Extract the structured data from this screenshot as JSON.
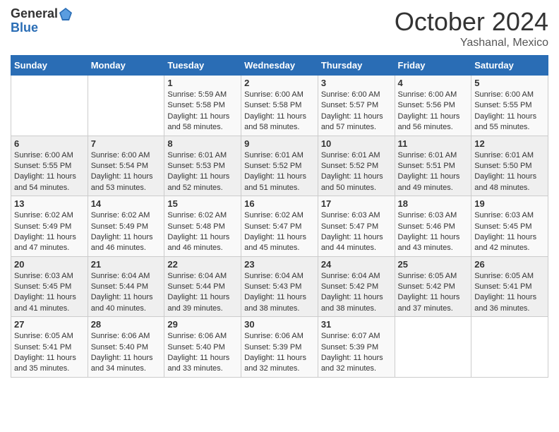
{
  "header": {
    "logo": {
      "general": "General",
      "blue": "Blue"
    },
    "title": "October 2024",
    "location": "Yashanal, Mexico"
  },
  "weekdays": [
    "Sunday",
    "Monday",
    "Tuesday",
    "Wednesday",
    "Thursday",
    "Friday",
    "Saturday"
  ],
  "weeks": [
    [
      {
        "day": "",
        "info": ""
      },
      {
        "day": "",
        "info": ""
      },
      {
        "day": "1",
        "info": "Sunrise: 5:59 AM\nSunset: 5:58 PM\nDaylight: 11 hours and 58 minutes."
      },
      {
        "day": "2",
        "info": "Sunrise: 6:00 AM\nSunset: 5:58 PM\nDaylight: 11 hours and 58 minutes."
      },
      {
        "day": "3",
        "info": "Sunrise: 6:00 AM\nSunset: 5:57 PM\nDaylight: 11 hours and 57 minutes."
      },
      {
        "day": "4",
        "info": "Sunrise: 6:00 AM\nSunset: 5:56 PM\nDaylight: 11 hours and 56 minutes."
      },
      {
        "day": "5",
        "info": "Sunrise: 6:00 AM\nSunset: 5:55 PM\nDaylight: 11 hours and 55 minutes."
      }
    ],
    [
      {
        "day": "6",
        "info": "Sunrise: 6:00 AM\nSunset: 5:55 PM\nDaylight: 11 hours and 54 minutes."
      },
      {
        "day": "7",
        "info": "Sunrise: 6:00 AM\nSunset: 5:54 PM\nDaylight: 11 hours and 53 minutes."
      },
      {
        "day": "8",
        "info": "Sunrise: 6:01 AM\nSunset: 5:53 PM\nDaylight: 11 hours and 52 minutes."
      },
      {
        "day": "9",
        "info": "Sunrise: 6:01 AM\nSunset: 5:52 PM\nDaylight: 11 hours and 51 minutes."
      },
      {
        "day": "10",
        "info": "Sunrise: 6:01 AM\nSunset: 5:52 PM\nDaylight: 11 hours and 50 minutes."
      },
      {
        "day": "11",
        "info": "Sunrise: 6:01 AM\nSunset: 5:51 PM\nDaylight: 11 hours and 49 minutes."
      },
      {
        "day": "12",
        "info": "Sunrise: 6:01 AM\nSunset: 5:50 PM\nDaylight: 11 hours and 48 minutes."
      }
    ],
    [
      {
        "day": "13",
        "info": "Sunrise: 6:02 AM\nSunset: 5:49 PM\nDaylight: 11 hours and 47 minutes."
      },
      {
        "day": "14",
        "info": "Sunrise: 6:02 AM\nSunset: 5:49 PM\nDaylight: 11 hours and 46 minutes."
      },
      {
        "day": "15",
        "info": "Sunrise: 6:02 AM\nSunset: 5:48 PM\nDaylight: 11 hours and 46 minutes."
      },
      {
        "day": "16",
        "info": "Sunrise: 6:02 AM\nSunset: 5:47 PM\nDaylight: 11 hours and 45 minutes."
      },
      {
        "day": "17",
        "info": "Sunrise: 6:03 AM\nSunset: 5:47 PM\nDaylight: 11 hours and 44 minutes."
      },
      {
        "day": "18",
        "info": "Sunrise: 6:03 AM\nSunset: 5:46 PM\nDaylight: 11 hours and 43 minutes."
      },
      {
        "day": "19",
        "info": "Sunrise: 6:03 AM\nSunset: 5:45 PM\nDaylight: 11 hours and 42 minutes."
      }
    ],
    [
      {
        "day": "20",
        "info": "Sunrise: 6:03 AM\nSunset: 5:45 PM\nDaylight: 11 hours and 41 minutes."
      },
      {
        "day": "21",
        "info": "Sunrise: 6:04 AM\nSunset: 5:44 PM\nDaylight: 11 hours and 40 minutes."
      },
      {
        "day": "22",
        "info": "Sunrise: 6:04 AM\nSunset: 5:44 PM\nDaylight: 11 hours and 39 minutes."
      },
      {
        "day": "23",
        "info": "Sunrise: 6:04 AM\nSunset: 5:43 PM\nDaylight: 11 hours and 38 minutes."
      },
      {
        "day": "24",
        "info": "Sunrise: 6:04 AM\nSunset: 5:42 PM\nDaylight: 11 hours and 38 minutes."
      },
      {
        "day": "25",
        "info": "Sunrise: 6:05 AM\nSunset: 5:42 PM\nDaylight: 11 hours and 37 minutes."
      },
      {
        "day": "26",
        "info": "Sunrise: 6:05 AM\nSunset: 5:41 PM\nDaylight: 11 hours and 36 minutes."
      }
    ],
    [
      {
        "day": "27",
        "info": "Sunrise: 6:05 AM\nSunset: 5:41 PM\nDaylight: 11 hours and 35 minutes."
      },
      {
        "day": "28",
        "info": "Sunrise: 6:06 AM\nSunset: 5:40 PM\nDaylight: 11 hours and 34 minutes."
      },
      {
        "day": "29",
        "info": "Sunrise: 6:06 AM\nSunset: 5:40 PM\nDaylight: 11 hours and 33 minutes."
      },
      {
        "day": "30",
        "info": "Sunrise: 6:06 AM\nSunset: 5:39 PM\nDaylight: 11 hours and 32 minutes."
      },
      {
        "day": "31",
        "info": "Sunrise: 6:07 AM\nSunset: 5:39 PM\nDaylight: 11 hours and 32 minutes."
      },
      {
        "day": "",
        "info": ""
      },
      {
        "day": "",
        "info": ""
      }
    ]
  ]
}
